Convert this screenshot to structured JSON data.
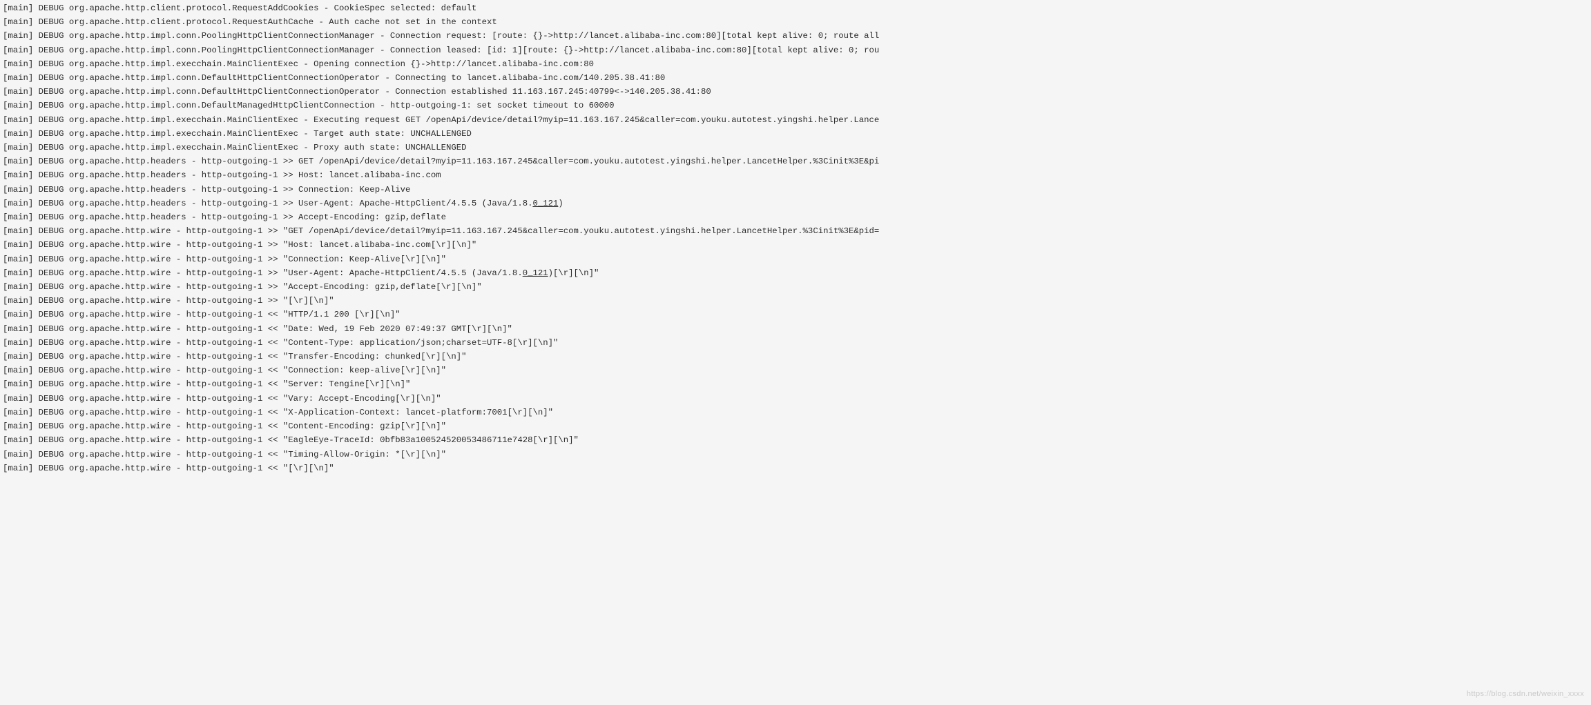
{
  "watermark": "https://blog.csdn.net/weixin_xxxx",
  "logs": [
    "[main] DEBUG org.apache.http.client.protocol.RequestAddCookies - CookieSpec selected: default",
    "[main] DEBUG org.apache.http.client.protocol.RequestAuthCache - Auth cache not set in the context",
    "[main] DEBUG org.apache.http.impl.conn.PoolingHttpClientConnectionManager - Connection request: [route: {}->http://lancet.alibaba-inc.com:80][total kept alive: 0; route all",
    "[main] DEBUG org.apache.http.impl.conn.PoolingHttpClientConnectionManager - Connection leased: [id: 1][route: {}->http://lancet.alibaba-inc.com:80][total kept alive: 0; rou",
    "[main] DEBUG org.apache.http.impl.execchain.MainClientExec - Opening connection {}->http://lancet.alibaba-inc.com:80",
    "[main] DEBUG org.apache.http.impl.conn.DefaultHttpClientConnectionOperator - Connecting to lancet.alibaba-inc.com/140.205.38.41:80",
    "[main] DEBUG org.apache.http.impl.conn.DefaultHttpClientConnectionOperator - Connection established 11.163.167.245:40799<->140.205.38.41:80",
    "[main] DEBUG org.apache.http.impl.conn.DefaultManagedHttpClientConnection - http-outgoing-1: set socket timeout to 60000",
    "[main] DEBUG org.apache.http.impl.execchain.MainClientExec - Executing request GET /openApi/device/detail?myip=11.163.167.245&caller=com.youku.autotest.yingshi.helper.Lance",
    "[main] DEBUG org.apache.http.impl.execchain.MainClientExec - Target auth state: UNCHALLENGED",
    "[main] DEBUG org.apache.http.impl.execchain.MainClientExec - Proxy auth state: UNCHALLENGED",
    "[main] DEBUG org.apache.http.headers - http-outgoing-1 >> GET /openApi/device/detail?myip=11.163.167.245&caller=com.youku.autotest.yingshi.helper.LancetHelper.%3Cinit%3E&pi",
    "[main] DEBUG org.apache.http.headers - http-outgoing-1 >> Host: lancet.alibaba-inc.com",
    "[main] DEBUG org.apache.http.headers - http-outgoing-1 >> Connection: Keep-Alive",
    "[main] DEBUG org.apache.http.headers - http-outgoing-1 >> User-Agent: Apache-HttpClient/4.5.5 (Java/1.8.0_121)",
    "[main] DEBUG org.apache.http.headers - http-outgoing-1 >> Accept-Encoding: gzip,deflate",
    "[main] DEBUG org.apache.http.wire - http-outgoing-1 >> \"GET /openApi/device/detail?myip=11.163.167.245&caller=com.youku.autotest.yingshi.helper.LancetHelper.%3Cinit%3E&pid=",
    "[main] DEBUG org.apache.http.wire - http-outgoing-1 >> \"Host: lancet.alibaba-inc.com[\\r][\\n]\"",
    "[main] DEBUG org.apache.http.wire - http-outgoing-1 >> \"Connection: Keep-Alive[\\r][\\n]\"",
    "[main] DEBUG org.apache.http.wire - http-outgoing-1 >> \"User-Agent: Apache-HttpClient/4.5.5 (Java/1.8.0_121)[\\r][\\n]\"",
    "[main] DEBUG org.apache.http.wire - http-outgoing-1 >> \"Accept-Encoding: gzip,deflate[\\r][\\n]\"",
    "[main] DEBUG org.apache.http.wire - http-outgoing-1 >> \"[\\r][\\n]\"",
    "[main] DEBUG org.apache.http.wire - http-outgoing-1 << \"HTTP/1.1 200 [\\r][\\n]\"",
    "[main] DEBUG org.apache.http.wire - http-outgoing-1 << \"Date: Wed, 19 Feb 2020 07:49:37 GMT[\\r][\\n]\"",
    "[main] DEBUG org.apache.http.wire - http-outgoing-1 << \"Content-Type: application/json;charset=UTF-8[\\r][\\n]\"",
    "[main] DEBUG org.apache.http.wire - http-outgoing-1 << \"Transfer-Encoding: chunked[\\r][\\n]\"",
    "[main] DEBUG org.apache.http.wire - http-outgoing-1 << \"Connection: keep-alive[\\r][\\n]\"",
    "[main] DEBUG org.apache.http.wire - http-outgoing-1 << \"Server: Tengine[\\r][\\n]\"",
    "[main] DEBUG org.apache.http.wire - http-outgoing-1 << \"Vary: Accept-Encoding[\\r][\\n]\"",
    "[main] DEBUG org.apache.http.wire - http-outgoing-1 << \"X-Application-Context: lancet-platform:7001[\\r][\\n]\"",
    "[main] DEBUG org.apache.http.wire - http-outgoing-1 << \"Content-Encoding: gzip[\\r][\\n]\"",
    "[main] DEBUG org.apache.http.wire - http-outgoing-1 << \"EagleEye-TraceId: 0bfb83a100524520053486711e7428[\\r][\\n]\"",
    "[main] DEBUG org.apache.http.wire - http-outgoing-1 << \"Timing-Allow-Origin: *[\\r][\\n]\"",
    "[main] DEBUG org.apache.http.wire - http-outgoing-1 << \"[\\r][\\n]\""
  ]
}
